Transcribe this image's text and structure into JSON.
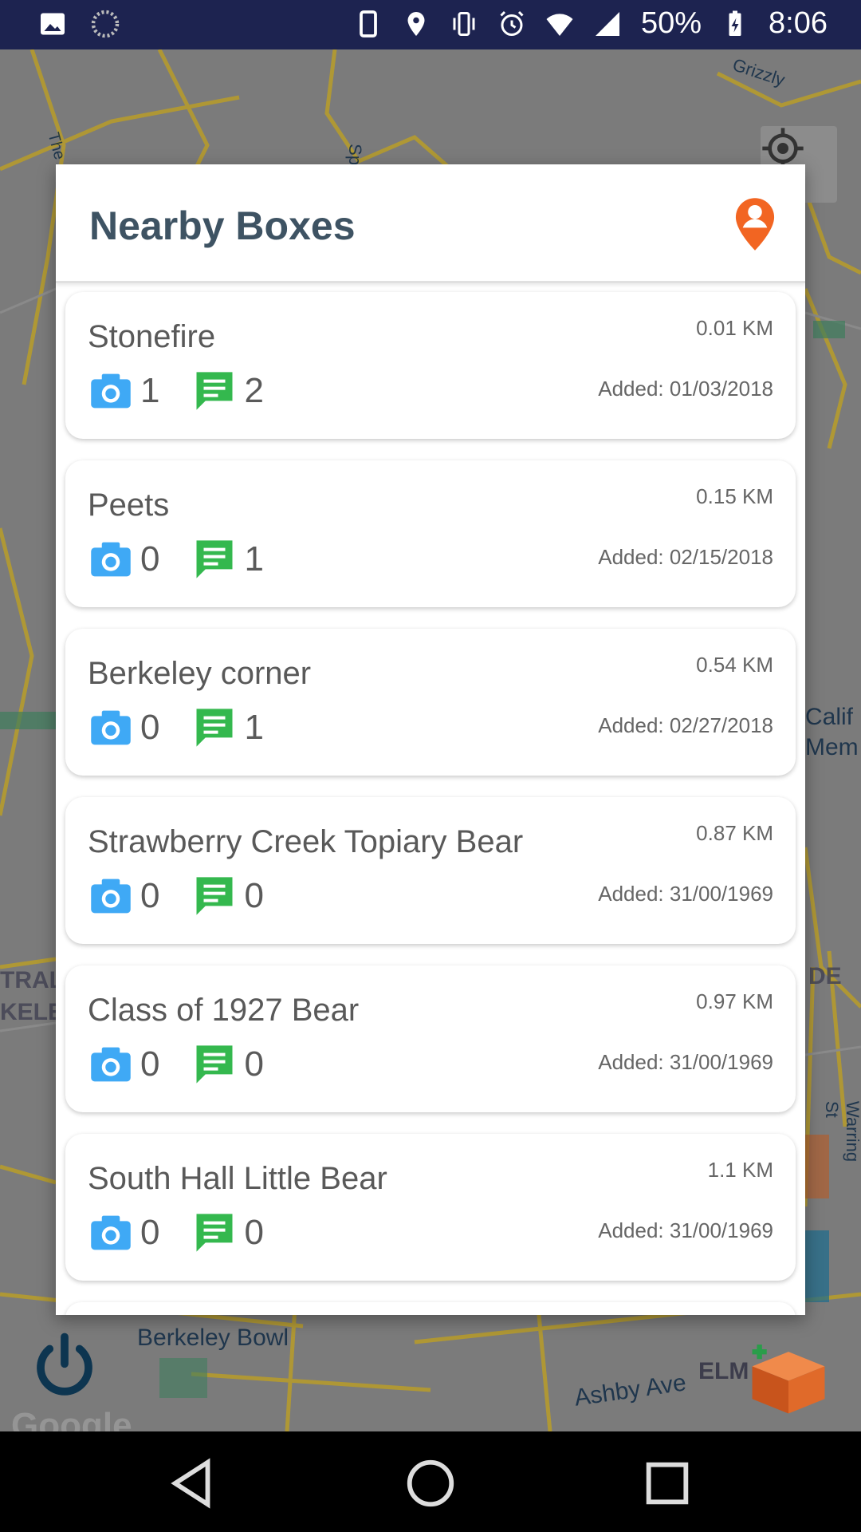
{
  "status_bar": {
    "battery": "50%",
    "time": "8:06"
  },
  "map": {
    "labels": {
      "berkeley_bowl": "Berkeley Bowl",
      "ashby_ave": "Ashby Ave",
      "elm": "ELM",
      "calif": "Calif",
      "mem": "Mem",
      "spruce": "Spruce",
      "grizzly": "Grizzly",
      "the_alameda": "The Alameda",
      "tral": "TRAL",
      "keley": "KELEY",
      "de": "DE",
      "warring": "Warring St",
      "google": "Google"
    }
  },
  "dialog": {
    "title": "Nearby Boxes",
    "boxes": [
      {
        "name": "Stonefire",
        "photos": "1",
        "messages": "2",
        "distance": "0.01 KM",
        "added": "Added: 01/03/2018"
      },
      {
        "name": "Peets",
        "photos": "0",
        "messages": "1",
        "distance": "0.15 KM",
        "added": "Added: 02/15/2018"
      },
      {
        "name": "Berkeley corner",
        "photos": "0",
        "messages": "1",
        "distance": "0.54 KM",
        "added": "Added: 02/27/2018"
      },
      {
        "name": "Strawberry Creek Topiary Bear",
        "photos": "0",
        "messages": "0",
        "distance": "0.87 KM",
        "added": "Added: 31/00/1969"
      },
      {
        "name": "Class of 1927 Bear",
        "photos": "0",
        "messages": "0",
        "distance": "0.97 KM",
        "added": "Added: 31/00/1969"
      },
      {
        "name": "South Hall Little Bear",
        "photos": "0",
        "messages": "0",
        "distance": "1.1 KM",
        "added": "Added: 31/00/1969"
      }
    ]
  },
  "colors": {
    "camera": "#3fa9f5",
    "message": "#34b84e",
    "pin": "#f26522",
    "title": "#3e5363",
    "status_bar": "#1d2350"
  },
  "icons": {
    "camera": "camera-icon",
    "message": "message-icon",
    "pin": "location-pin-icon",
    "power": "power-icon",
    "box": "box-icon",
    "locate": "my-location-icon"
  }
}
